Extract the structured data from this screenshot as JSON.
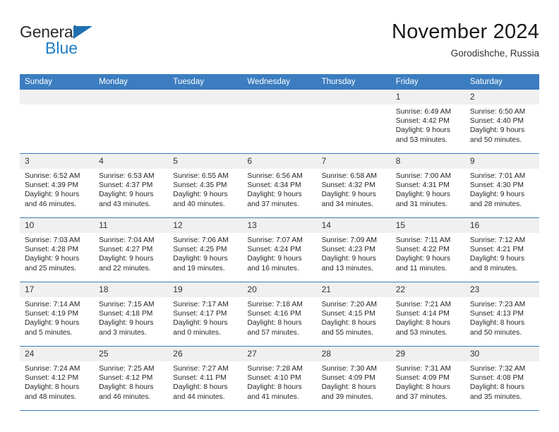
{
  "brand": {
    "name_top": "General",
    "name_bottom": "Blue",
    "accent_color": "#1f7ec4",
    "triangle_color": "#1f6fb2"
  },
  "header": {
    "title": "November 2024",
    "location": "Gorodishche, Russia"
  },
  "theme": {
    "header_row_bg": "#3b7dc0",
    "daynum_bg": "#f0f0f0",
    "row_divider": "#3b7dc0",
    "page_bg": "#ffffff",
    "text": "#262626"
  },
  "weekday_headers": [
    "Sunday",
    "Monday",
    "Tuesday",
    "Wednesday",
    "Thursday",
    "Friday",
    "Saturday"
  ],
  "weeks": [
    [
      {
        "day": "",
        "empty": true,
        "sunrise": "",
        "sunset": "",
        "daylight_line1": "",
        "daylight_line2": ""
      },
      {
        "day": "",
        "empty": true,
        "sunrise": "",
        "sunset": "",
        "daylight_line1": "",
        "daylight_line2": ""
      },
      {
        "day": "",
        "empty": true,
        "sunrise": "",
        "sunset": "",
        "daylight_line1": "",
        "daylight_line2": ""
      },
      {
        "day": "",
        "empty": true,
        "sunrise": "",
        "sunset": "",
        "daylight_line1": "",
        "daylight_line2": ""
      },
      {
        "day": "",
        "empty": true,
        "sunrise": "",
        "sunset": "",
        "daylight_line1": "",
        "daylight_line2": ""
      },
      {
        "day": "1",
        "empty": false,
        "sunrise": "Sunrise: 6:49 AM",
        "sunset": "Sunset: 4:42 PM",
        "daylight_line1": "Daylight: 9 hours",
        "daylight_line2": "and 53 minutes."
      },
      {
        "day": "2",
        "empty": false,
        "sunrise": "Sunrise: 6:50 AM",
        "sunset": "Sunset: 4:40 PM",
        "daylight_line1": "Daylight: 9 hours",
        "daylight_line2": "and 50 minutes."
      }
    ],
    [
      {
        "day": "3",
        "empty": false,
        "sunrise": "Sunrise: 6:52 AM",
        "sunset": "Sunset: 4:39 PM",
        "daylight_line1": "Daylight: 9 hours",
        "daylight_line2": "and 46 minutes."
      },
      {
        "day": "4",
        "empty": false,
        "sunrise": "Sunrise: 6:53 AM",
        "sunset": "Sunset: 4:37 PM",
        "daylight_line1": "Daylight: 9 hours",
        "daylight_line2": "and 43 minutes."
      },
      {
        "day": "5",
        "empty": false,
        "sunrise": "Sunrise: 6:55 AM",
        "sunset": "Sunset: 4:35 PM",
        "daylight_line1": "Daylight: 9 hours",
        "daylight_line2": "and 40 minutes."
      },
      {
        "day": "6",
        "empty": false,
        "sunrise": "Sunrise: 6:56 AM",
        "sunset": "Sunset: 4:34 PM",
        "daylight_line1": "Daylight: 9 hours",
        "daylight_line2": "and 37 minutes."
      },
      {
        "day": "7",
        "empty": false,
        "sunrise": "Sunrise: 6:58 AM",
        "sunset": "Sunset: 4:32 PM",
        "daylight_line1": "Daylight: 9 hours",
        "daylight_line2": "and 34 minutes."
      },
      {
        "day": "8",
        "empty": false,
        "sunrise": "Sunrise: 7:00 AM",
        "sunset": "Sunset: 4:31 PM",
        "daylight_line1": "Daylight: 9 hours",
        "daylight_line2": "and 31 minutes."
      },
      {
        "day": "9",
        "empty": false,
        "sunrise": "Sunrise: 7:01 AM",
        "sunset": "Sunset: 4:30 PM",
        "daylight_line1": "Daylight: 9 hours",
        "daylight_line2": "and 28 minutes."
      }
    ],
    [
      {
        "day": "10",
        "empty": false,
        "sunrise": "Sunrise: 7:03 AM",
        "sunset": "Sunset: 4:28 PM",
        "daylight_line1": "Daylight: 9 hours",
        "daylight_line2": "and 25 minutes."
      },
      {
        "day": "11",
        "empty": false,
        "sunrise": "Sunrise: 7:04 AM",
        "sunset": "Sunset: 4:27 PM",
        "daylight_line1": "Daylight: 9 hours",
        "daylight_line2": "and 22 minutes."
      },
      {
        "day": "12",
        "empty": false,
        "sunrise": "Sunrise: 7:06 AM",
        "sunset": "Sunset: 4:25 PM",
        "daylight_line1": "Daylight: 9 hours",
        "daylight_line2": "and 19 minutes."
      },
      {
        "day": "13",
        "empty": false,
        "sunrise": "Sunrise: 7:07 AM",
        "sunset": "Sunset: 4:24 PM",
        "daylight_line1": "Daylight: 9 hours",
        "daylight_line2": "and 16 minutes."
      },
      {
        "day": "14",
        "empty": false,
        "sunrise": "Sunrise: 7:09 AM",
        "sunset": "Sunset: 4:23 PM",
        "daylight_line1": "Daylight: 9 hours",
        "daylight_line2": "and 13 minutes."
      },
      {
        "day": "15",
        "empty": false,
        "sunrise": "Sunrise: 7:11 AM",
        "sunset": "Sunset: 4:22 PM",
        "daylight_line1": "Daylight: 9 hours",
        "daylight_line2": "and 11 minutes."
      },
      {
        "day": "16",
        "empty": false,
        "sunrise": "Sunrise: 7:12 AM",
        "sunset": "Sunset: 4:21 PM",
        "daylight_line1": "Daylight: 9 hours",
        "daylight_line2": "and 8 minutes."
      }
    ],
    [
      {
        "day": "17",
        "empty": false,
        "sunrise": "Sunrise: 7:14 AM",
        "sunset": "Sunset: 4:19 PM",
        "daylight_line1": "Daylight: 9 hours",
        "daylight_line2": "and 5 minutes."
      },
      {
        "day": "18",
        "empty": false,
        "sunrise": "Sunrise: 7:15 AM",
        "sunset": "Sunset: 4:18 PM",
        "daylight_line1": "Daylight: 9 hours",
        "daylight_line2": "and 3 minutes."
      },
      {
        "day": "19",
        "empty": false,
        "sunrise": "Sunrise: 7:17 AM",
        "sunset": "Sunset: 4:17 PM",
        "daylight_line1": "Daylight: 9 hours",
        "daylight_line2": "and 0 minutes."
      },
      {
        "day": "20",
        "empty": false,
        "sunrise": "Sunrise: 7:18 AM",
        "sunset": "Sunset: 4:16 PM",
        "daylight_line1": "Daylight: 8 hours",
        "daylight_line2": "and 57 minutes."
      },
      {
        "day": "21",
        "empty": false,
        "sunrise": "Sunrise: 7:20 AM",
        "sunset": "Sunset: 4:15 PM",
        "daylight_line1": "Daylight: 8 hours",
        "daylight_line2": "and 55 minutes."
      },
      {
        "day": "22",
        "empty": false,
        "sunrise": "Sunrise: 7:21 AM",
        "sunset": "Sunset: 4:14 PM",
        "daylight_line1": "Daylight: 8 hours",
        "daylight_line2": "and 53 minutes."
      },
      {
        "day": "23",
        "empty": false,
        "sunrise": "Sunrise: 7:23 AM",
        "sunset": "Sunset: 4:13 PM",
        "daylight_line1": "Daylight: 8 hours",
        "daylight_line2": "and 50 minutes."
      }
    ],
    [
      {
        "day": "24",
        "empty": false,
        "sunrise": "Sunrise: 7:24 AM",
        "sunset": "Sunset: 4:12 PM",
        "daylight_line1": "Daylight: 8 hours",
        "daylight_line2": "and 48 minutes."
      },
      {
        "day": "25",
        "empty": false,
        "sunrise": "Sunrise: 7:25 AM",
        "sunset": "Sunset: 4:12 PM",
        "daylight_line1": "Daylight: 8 hours",
        "daylight_line2": "and 46 minutes."
      },
      {
        "day": "26",
        "empty": false,
        "sunrise": "Sunrise: 7:27 AM",
        "sunset": "Sunset: 4:11 PM",
        "daylight_line1": "Daylight: 8 hours",
        "daylight_line2": "and 44 minutes."
      },
      {
        "day": "27",
        "empty": false,
        "sunrise": "Sunrise: 7:28 AM",
        "sunset": "Sunset: 4:10 PM",
        "daylight_line1": "Daylight: 8 hours",
        "daylight_line2": "and 41 minutes."
      },
      {
        "day": "28",
        "empty": false,
        "sunrise": "Sunrise: 7:30 AM",
        "sunset": "Sunset: 4:09 PM",
        "daylight_line1": "Daylight: 8 hours",
        "daylight_line2": "and 39 minutes."
      },
      {
        "day": "29",
        "empty": false,
        "sunrise": "Sunrise: 7:31 AM",
        "sunset": "Sunset: 4:09 PM",
        "daylight_line1": "Daylight: 8 hours",
        "daylight_line2": "and 37 minutes."
      },
      {
        "day": "30",
        "empty": false,
        "sunrise": "Sunrise: 7:32 AM",
        "sunset": "Sunset: 4:08 PM",
        "daylight_line1": "Daylight: 8 hours",
        "daylight_line2": "and 35 minutes."
      }
    ]
  ]
}
